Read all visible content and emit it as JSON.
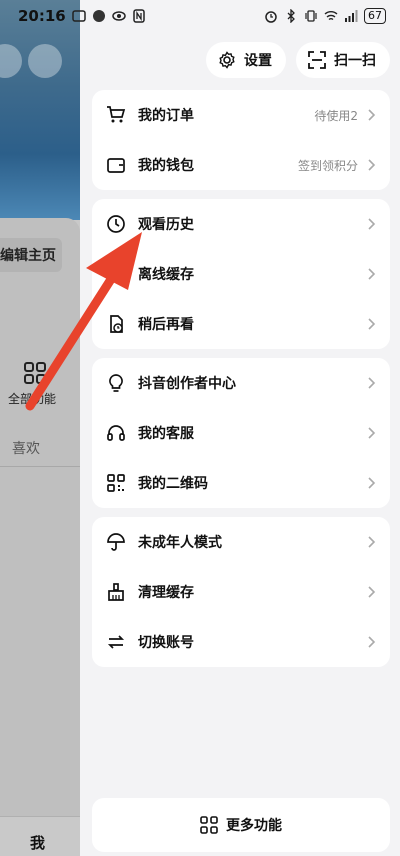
{
  "status_bar": {
    "time": "20:16",
    "battery": "67"
  },
  "background_page": {
    "edit_label": "编辑主页",
    "all_functions": "全部功能",
    "likes_tab": "喜欢",
    "me_tab": "我"
  },
  "header": {
    "settings_label": "设置",
    "scan_label": "扫一扫"
  },
  "groups": [
    {
      "items": [
        {
          "label": "我的订单",
          "extra": "待使用2",
          "icon": "cart-icon"
        },
        {
          "label": "我的钱包",
          "extra": "签到领积分",
          "icon": "wallet-icon"
        }
      ]
    },
    {
      "items": [
        {
          "label": "观看历史",
          "extra": "",
          "icon": "clock-icon"
        },
        {
          "label": "离线缓存",
          "extra": "",
          "icon": "download-icon"
        },
        {
          "label": "稍后再看",
          "extra": "",
          "icon": "watch-later-icon"
        }
      ]
    },
    {
      "items": [
        {
          "label": "抖音创作者中心",
          "extra": "",
          "icon": "lightbulb-icon"
        },
        {
          "label": "我的客服",
          "extra": "",
          "icon": "headset-icon"
        },
        {
          "label": "我的二维码",
          "extra": "",
          "icon": "qrcode-icon"
        }
      ]
    },
    {
      "items": [
        {
          "label": "未成年人模式",
          "extra": "",
          "icon": "umbrella-icon"
        },
        {
          "label": "清理缓存",
          "extra": "",
          "icon": "broom-icon"
        },
        {
          "label": "切换账号",
          "extra": "",
          "icon": "switch-icon"
        }
      ]
    }
  ],
  "more_functions": "更多功能",
  "colors": {
    "annotation_arrow": "#e8432c",
    "drawer_bg": "#f3f3f5"
  }
}
